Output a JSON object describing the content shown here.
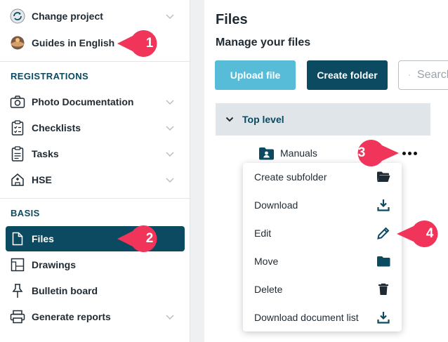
{
  "sidebar": {
    "change_project": "Change project",
    "project_name": "Guides in English",
    "registrations_heading": "REGISTRATIONS",
    "registrations": [
      {
        "label": "Photo Documentation"
      },
      {
        "label": "Checklists"
      },
      {
        "label": "Tasks"
      },
      {
        "label": "HSE"
      }
    ],
    "basis_heading": "BASIS",
    "basis": [
      {
        "label": "Files"
      },
      {
        "label": "Drawings"
      },
      {
        "label": "Bulletin board"
      },
      {
        "label": "Generate reports"
      }
    ]
  },
  "main": {
    "title": "Files",
    "subtitle": "Manage your files",
    "upload_label": "Upload file",
    "create_folder_label": "Create folder",
    "search_placeholder": "Search",
    "top_level_label": "Top level",
    "folder_name": "Manuals"
  },
  "context_menu": {
    "items": [
      {
        "label": "Create subfolder",
        "icon": "folder-open-icon"
      },
      {
        "label": "Download",
        "icon": "download-icon"
      },
      {
        "label": "Edit",
        "icon": "pencil-icon"
      },
      {
        "label": "Move",
        "icon": "folder-icon"
      },
      {
        "label": "Delete",
        "icon": "trash-icon"
      },
      {
        "label": "Download document list",
        "icon": "download-icon"
      }
    ]
  },
  "callouts": [
    "1",
    "2",
    "3",
    "4"
  ],
  "colors": {
    "primary": "#0b4a60",
    "accent": "#56bcd7",
    "callout": "#f0345a",
    "toplevel_bg": "#dfe5e8"
  }
}
